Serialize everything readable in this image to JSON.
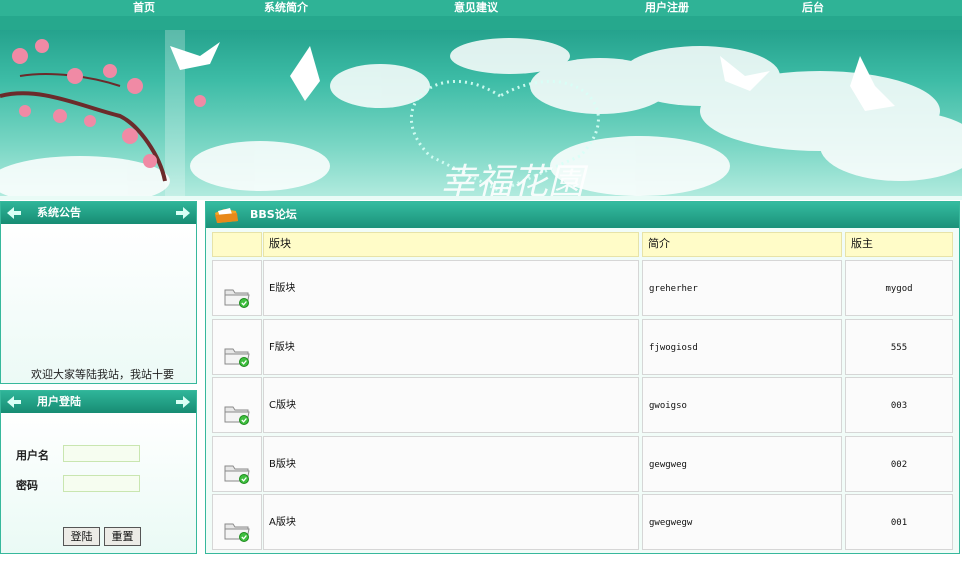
{
  "nav": {
    "items": [
      {
        "label": "首页"
      },
      {
        "label": "系统简介"
      },
      {
        "label": "意见建议"
      },
      {
        "label": "用户注册"
      },
      {
        "label": "后台"
      }
    ]
  },
  "notice": {
    "title": "系统公告",
    "text": "欢迎大家等陆我站，我站十要"
  },
  "login": {
    "title": "用户登陆",
    "username_label": "用户名",
    "password_label": "密码",
    "username_value": "",
    "password_value": "",
    "login_button": "登陆",
    "reset_button": "重置"
  },
  "forum": {
    "title": "BBS论坛",
    "columns": {
      "board": "版块",
      "desc": "简介",
      "owner": "版主"
    },
    "rows": [
      {
        "board": "E版块",
        "desc": "greherher",
        "owner": "mygod"
      },
      {
        "board": "F版块",
        "desc": "fjwogiosd",
        "owner": "555"
      },
      {
        "board": "C版块",
        "desc": "gwoigso",
        "owner": "003"
      },
      {
        "board": "B版块",
        "desc": "gewgweg",
        "owner": "002"
      },
      {
        "board": "A版块",
        "desc": "gwegwegw",
        "owner": "001"
      }
    ]
  },
  "colors": {
    "accent": "#2fb396",
    "header_cell": "#fffcc8"
  }
}
